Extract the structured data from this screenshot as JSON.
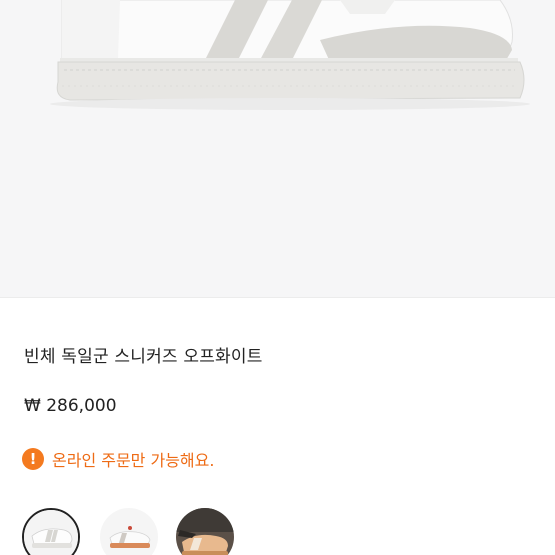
{
  "product": {
    "image_alt": "sneaker-product-photo",
    "title": "빈체 독일군 스니커즈 오프화이트",
    "price": "₩ 286,000"
  },
  "notice": {
    "icon": "exclamation-icon",
    "text": "온라인 주문만 가능해요.",
    "accent_color": "#f47a1f",
    "text_color": "#ee6b15"
  },
  "thumbnails": [
    {
      "name": "thumbnail-side-view",
      "selected": true
    },
    {
      "name": "thumbnail-top-view",
      "selected": false
    },
    {
      "name": "thumbnail-worn-view",
      "selected": false
    }
  ]
}
